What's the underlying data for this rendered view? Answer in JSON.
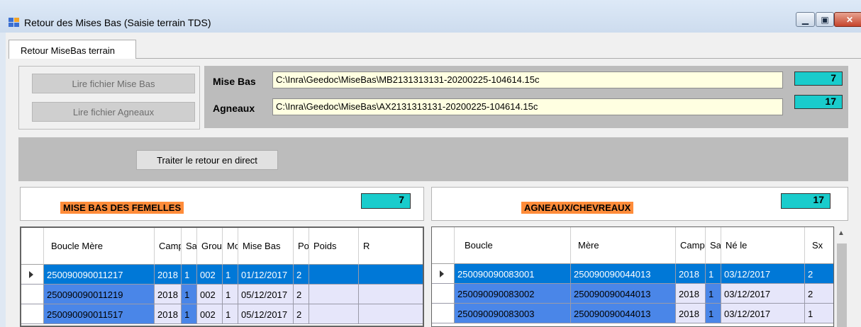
{
  "window": {
    "title": "Retour des Mises Bas (Saisie terrain TDS)"
  },
  "tabs": [
    {
      "label": "Retour MiseBas terrain"
    }
  ],
  "buttons": {
    "read_birth_file": "Lire fichier Mise Bas",
    "read_lambs_file": "Lire fichier Agneaux",
    "process_direct": "Traiter le retour en direct"
  },
  "files": {
    "mise_bas_label": "Mise Bas",
    "mise_bas_path": "C:\\Inra\\Geedoc\\MiseBas\\MB2131313131-20200225-104614.15c",
    "mise_bas_count": "7",
    "agneaux_label": "Agneaux",
    "agneaux_path": "C:\\Inra\\Geedoc\\MiseBas\\AX2131313131-20200225-104614.15c",
    "agneaux_count": "17"
  },
  "left_panel": {
    "title": "MISE BAS DES FEMELLES",
    "count": "7",
    "columns": [
      "Boucle Mère",
      "Campa",
      "Sa",
      "Grou",
      "Mo",
      "Mise Bas",
      "Po",
      "Poids",
      "R"
    ],
    "rows": [
      [
        "250090090011217",
        "2018",
        "1",
        "002",
        "1",
        "01/12/2017",
        "2",
        "",
        ""
      ],
      [
        "250090090011219",
        "2018",
        "1",
        "002",
        "1",
        "05/12/2017",
        "2",
        "",
        ""
      ],
      [
        "250090090011517",
        "2018",
        "1",
        "002",
        "1",
        "05/12/2017",
        "2",
        "",
        ""
      ]
    ]
  },
  "right_panel": {
    "title": "AGNEAUX/CHEVREAUX",
    "count": "17",
    "columns": [
      "Boucle",
      "Mère",
      "Campa",
      "Sa",
      "Né le",
      "Sx"
    ],
    "rows": [
      [
        "250090090083001",
        "250090090044013",
        "2018",
        "1",
        "03/12/2017",
        "2"
      ],
      [
        "250090090083002",
        "250090090044013",
        "2018",
        "1",
        "03/12/2017",
        "2"
      ],
      [
        "250090090083003",
        "250090090044013",
        "2018",
        "1",
        "03/12/2017",
        "1"
      ]
    ]
  },
  "colors": {
    "selected_row": "#0078d7",
    "key_cell": "#4a86e8",
    "row_fill": "#e6e6fa",
    "count_fill": "#19cccc",
    "title_fill": "#ff8c3a"
  }
}
